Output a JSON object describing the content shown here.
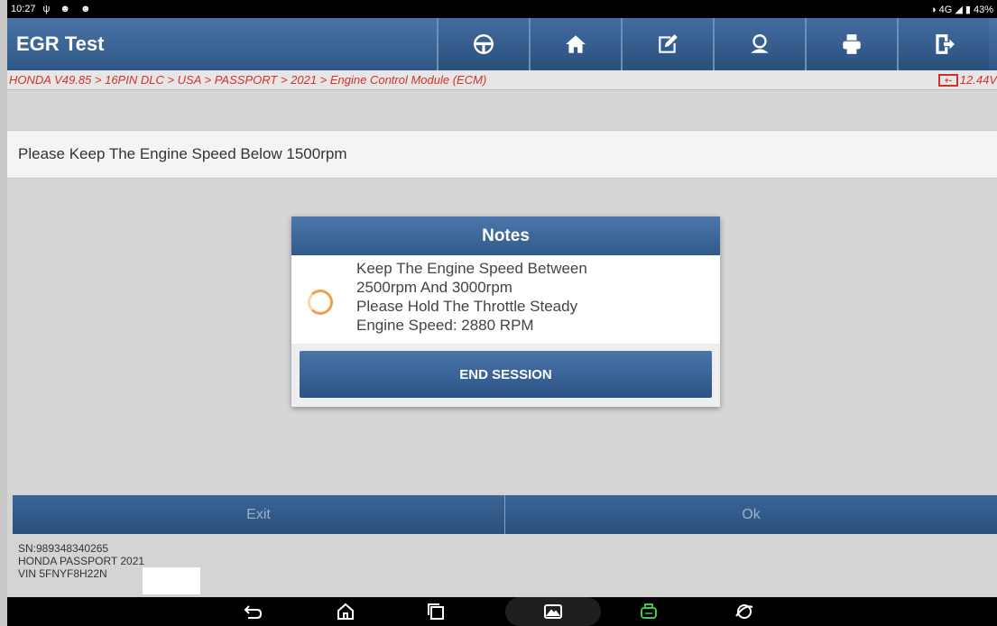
{
  "status_bar": {
    "time": "10:27",
    "left_icons": "ψ ☻ ☻",
    "right": "◑ 4G ◢ ▮ 43%"
  },
  "header": {
    "title": "EGR Test",
    "buttons": [
      {
        "icon": "steering-wheel-icon"
      },
      {
        "icon": "home-icon"
      },
      {
        "icon": "edit-icon"
      },
      {
        "icon": "user-icon"
      },
      {
        "icon": "print-icon"
      },
      {
        "icon": "exit-icon"
      }
    ]
  },
  "breadcrumb": "HONDA V49.85 > 16PIN DLC > USA > PASSPORT > 2021 > Engine Control Module (ECM)",
  "battery": {
    "icon_text": "+-",
    "voltage": "12.44V"
  },
  "instruction": "Please Keep The Engine Speed Below 1500rpm",
  "dialog": {
    "title": "Notes",
    "lines": [
      "Keep The Engine Speed Between",
      "2500rpm And 3000rpm",
      "Please Hold The Throttle Steady",
      "Engine Speed: 2880 RPM"
    ],
    "button": "END SESSION"
  },
  "buttons": {
    "exit": "Exit",
    "ok": "Ok"
  },
  "vehicle_info": {
    "sn": "SN:989348340265",
    "model": "HONDA PASSPORT 2021",
    "vin": "VIN 5FNYF8H22N"
  },
  "colors": {
    "header_blue": "#305a8a",
    "breadcrumb_red": "#d2312a",
    "spinner_orange": "#f0a049",
    "vci_green": "#3ccb3c"
  }
}
